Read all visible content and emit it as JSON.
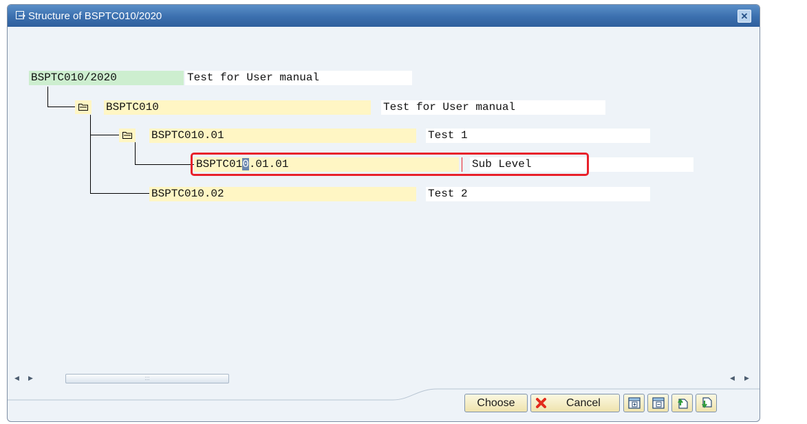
{
  "dialog": {
    "title": "Structure of BSPTC010/2020",
    "close_icon": "close-icon"
  },
  "tree": {
    "root": {
      "key": "BSPTC010/2020",
      "text": "Test for User manual"
    },
    "nodes": [
      {
        "key": "BSPTC010",
        "text": "Test for User manual",
        "level": 1,
        "folder": true
      },
      {
        "key": "BSPTC010.01",
        "text": "Test 1",
        "level": 2,
        "folder": true
      },
      {
        "key_before_cursor": "BSPTC01",
        "key_cursor": "0",
        "key_after_cursor": ".01.01",
        "text": "Sub Level",
        "level": 3,
        "folder": false,
        "highlighted": true
      },
      {
        "key": "BSPTC010.02",
        "text": "Test 2",
        "level": 2,
        "folder": false
      }
    ]
  },
  "scrollbar": {
    "thumb_grip": ":::"
  },
  "buttons": {
    "choose": "Choose",
    "cancel": "Cancel",
    "expand_icon": "expand-subtree-icon",
    "collapse_icon": "collapse-subtree-icon",
    "up_icon": "move-up-icon",
    "down_icon": "move-down-icon"
  },
  "colors": {
    "title_bar": "#3b6fae",
    "key_field": "#fff6c4",
    "root_key": "#cdeecf",
    "highlight": "#e8202a"
  }
}
